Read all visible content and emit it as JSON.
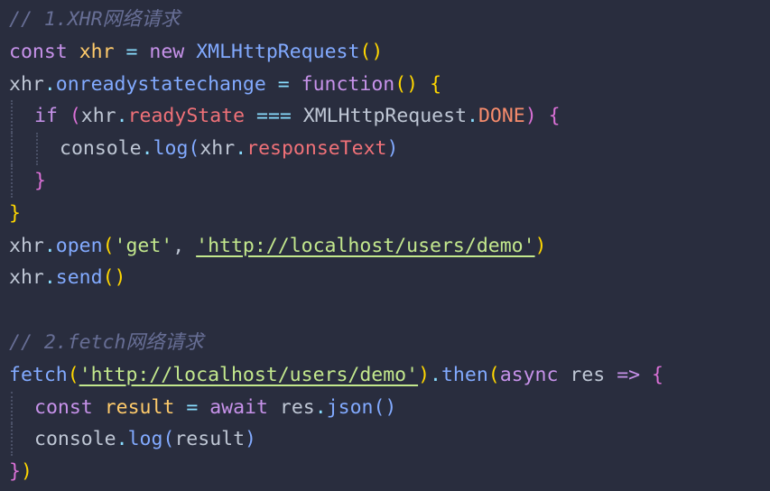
{
  "code": {
    "lines": [
      {
        "indent": 0,
        "tokens": [
          {
            "t": "// 1.XHR网络请求",
            "c": "comment"
          }
        ]
      },
      {
        "indent": 0,
        "tokens": [
          {
            "t": "const",
            "c": "keyword"
          },
          {
            "t": " ",
            "c": "plain"
          },
          {
            "t": "xhr",
            "c": "var"
          },
          {
            "t": " ",
            "c": "plain"
          },
          {
            "t": "=",
            "c": "op"
          },
          {
            "t": " ",
            "c": "plain"
          },
          {
            "t": "new",
            "c": "keyword"
          },
          {
            "t": " ",
            "c": "plain"
          },
          {
            "t": "XMLHttpRequest",
            "c": "func"
          },
          {
            "t": "()",
            "c": "paren"
          }
        ]
      },
      {
        "indent": 0,
        "tokens": [
          {
            "t": "xhr",
            "c": "plain"
          },
          {
            "t": ".",
            "c": "punct"
          },
          {
            "t": "onreadystatechange",
            "c": "func"
          },
          {
            "t": " ",
            "c": "plain"
          },
          {
            "t": "=",
            "c": "op"
          },
          {
            "t": " ",
            "c": "plain"
          },
          {
            "t": "function",
            "c": "keyword"
          },
          {
            "t": "()",
            "c": "paren"
          },
          {
            "t": " ",
            "c": "plain"
          },
          {
            "t": "{",
            "c": "brace"
          }
        ]
      },
      {
        "indent": 1,
        "tokens": [
          {
            "t": "if",
            "c": "keyword"
          },
          {
            "t": " ",
            "c": "plain"
          },
          {
            "t": "(",
            "c": "brace2"
          },
          {
            "t": "xhr",
            "c": "plain"
          },
          {
            "t": ".",
            "c": "punct"
          },
          {
            "t": "readyState",
            "c": "prop"
          },
          {
            "t": " ",
            "c": "plain"
          },
          {
            "t": "===",
            "c": "op"
          },
          {
            "t": " ",
            "c": "plain"
          },
          {
            "t": "XMLHttpRequest",
            "c": "plain"
          },
          {
            "t": ".",
            "c": "punct"
          },
          {
            "t": "DONE",
            "c": "const"
          },
          {
            "t": ")",
            "c": "brace2"
          },
          {
            "t": " ",
            "c": "plain"
          },
          {
            "t": "{",
            "c": "brace2"
          }
        ]
      },
      {
        "indent": 2,
        "tokens": [
          {
            "t": "console",
            "c": "plain"
          },
          {
            "t": ".",
            "c": "punct"
          },
          {
            "t": "log",
            "c": "func"
          },
          {
            "t": "(",
            "c": "func"
          },
          {
            "t": "xhr",
            "c": "plain"
          },
          {
            "t": ".",
            "c": "punct"
          },
          {
            "t": "responseText",
            "c": "prop"
          },
          {
            "t": ")",
            "c": "func"
          }
        ]
      },
      {
        "indent": 1,
        "tokens": [
          {
            "t": "}",
            "c": "brace2"
          }
        ]
      },
      {
        "indent": 0,
        "tokens": [
          {
            "t": "}",
            "c": "brace"
          }
        ]
      },
      {
        "indent": 0,
        "tokens": [
          {
            "t": "xhr",
            "c": "plain"
          },
          {
            "t": ".",
            "c": "punct"
          },
          {
            "t": "open",
            "c": "func"
          },
          {
            "t": "(",
            "c": "paren"
          },
          {
            "t": "'get'",
            "c": "string"
          },
          {
            "t": ", ",
            "c": "plain"
          },
          {
            "t": "'http://localhost/users/demo'",
            "c": "string-u"
          },
          {
            "t": ")",
            "c": "paren"
          }
        ]
      },
      {
        "indent": 0,
        "tokens": [
          {
            "t": "xhr",
            "c": "plain"
          },
          {
            "t": ".",
            "c": "punct"
          },
          {
            "t": "send",
            "c": "func"
          },
          {
            "t": "()",
            "c": "paren"
          }
        ]
      },
      {
        "indent": 0,
        "tokens": []
      },
      {
        "indent": 0,
        "tokens": [
          {
            "t": "// 2.fetch网络请求",
            "c": "comment"
          }
        ]
      },
      {
        "indent": 0,
        "tokens": [
          {
            "t": "fetch",
            "c": "func"
          },
          {
            "t": "(",
            "c": "paren"
          },
          {
            "t": "'http://localhost/users/demo'",
            "c": "string-u"
          },
          {
            "t": ")",
            "c": "paren"
          },
          {
            "t": ".",
            "c": "punct"
          },
          {
            "t": "then",
            "c": "func"
          },
          {
            "t": "(",
            "c": "paren"
          },
          {
            "t": "async",
            "c": "keyword"
          },
          {
            "t": " ",
            "c": "plain"
          },
          {
            "t": "res",
            "c": "plain"
          },
          {
            "t": " ",
            "c": "plain"
          },
          {
            "t": "=>",
            "c": "keyword"
          },
          {
            "t": " ",
            "c": "plain"
          },
          {
            "t": "{",
            "c": "brace2"
          }
        ]
      },
      {
        "indent": 1,
        "tokens": [
          {
            "t": "const",
            "c": "keyword"
          },
          {
            "t": " ",
            "c": "plain"
          },
          {
            "t": "result",
            "c": "var"
          },
          {
            "t": " ",
            "c": "plain"
          },
          {
            "t": "=",
            "c": "op"
          },
          {
            "t": " ",
            "c": "plain"
          },
          {
            "t": "await",
            "c": "keyword"
          },
          {
            "t": " ",
            "c": "plain"
          },
          {
            "t": "res",
            "c": "plain"
          },
          {
            "t": ".",
            "c": "punct"
          },
          {
            "t": "json",
            "c": "func"
          },
          {
            "t": "()",
            "c": "func"
          }
        ]
      },
      {
        "indent": 1,
        "tokens": [
          {
            "t": "console",
            "c": "plain"
          },
          {
            "t": ".",
            "c": "punct"
          },
          {
            "t": "log",
            "c": "func"
          },
          {
            "t": "(",
            "c": "func"
          },
          {
            "t": "result",
            "c": "plain"
          },
          {
            "t": ")",
            "c": "func"
          }
        ]
      },
      {
        "indent": 0,
        "tokens": [
          {
            "t": "}",
            "c": "brace2"
          },
          {
            "t": ")",
            "c": "paren"
          }
        ]
      }
    ]
  }
}
